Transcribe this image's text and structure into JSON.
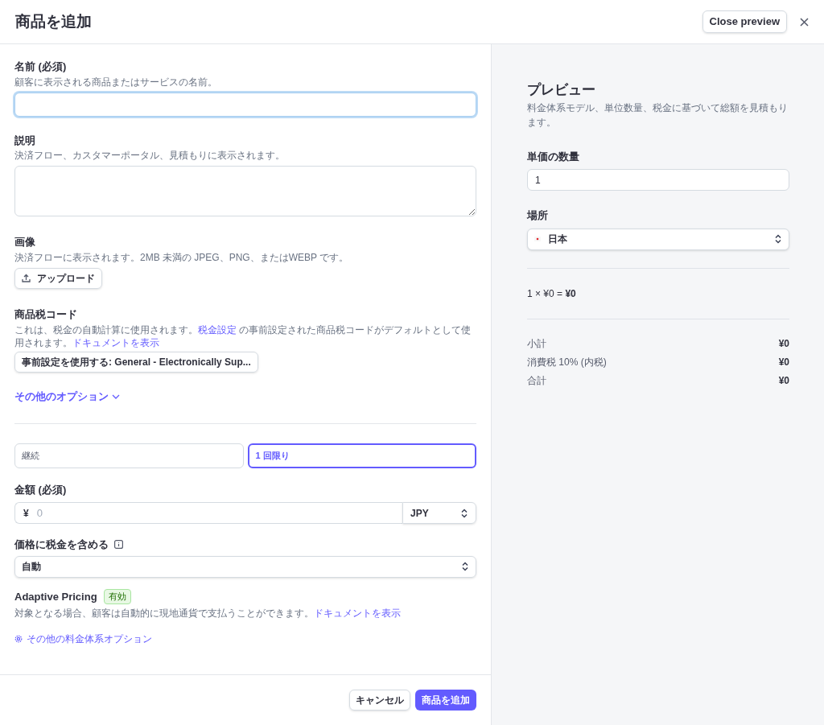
{
  "header": {
    "title": "商品を追加",
    "close_preview": "Close preview"
  },
  "name_field": {
    "label": "名前 (必須)",
    "hint": "顧客に表示される商品またはサービスの名前。",
    "focused": true
  },
  "description_field": {
    "label": "説明",
    "hint": "決済フロー、カスタマーポータル、見積もりに表示されます。"
  },
  "image_field": {
    "label": "画像",
    "hint": "決済フローに表示されます。2MB 未満の JPEG、PNG、またはWEBP です。",
    "button": "アップロード"
  },
  "tax_code": {
    "label": "商品税コード",
    "text_1": "これは、税金の自動計算に使用されます。",
    "link_1": "税金設定",
    "text_2": " の事前設定された商品税コードがデフォルトとして使用されます。",
    "link_2": "ドキュメントを表示",
    "button": "事前設定を使用する: General - Electronically Sup..."
  },
  "more_options": "その他のオプション",
  "pricing_types": [
    {
      "label": "継続",
      "selected": false
    },
    {
      "label": "1 回限り",
      "selected": true
    }
  ],
  "amount": {
    "label": "金額 (必須)",
    "symbol": "¥",
    "placeholder": "0",
    "currency": "JPY"
  },
  "tax_included": {
    "label": "価格に税金を含める",
    "value": "自動"
  },
  "adaptive_pricing": {
    "title": "Adaptive Pricing",
    "badge": "有効",
    "text": "対象となる場合、顧客は自動的に現地通貨で支払うことができます。",
    "link": "ドキュメントを表示"
  },
  "more_pricing_options": "その他の料金体系オプション",
  "footer": {
    "cancel": "キャンセル",
    "submit": "商品を追加"
  },
  "preview": {
    "title": "プレビュー",
    "subtitle": "料金体系モデル、単位数量、税金に基づいて総額を見積もります。",
    "quantity_label": "単価の数量",
    "quantity": "1",
    "location_label": "場所",
    "location": "日本",
    "formula": "1 × ¥0 = **¥0**",
    "summary": [
      {
        "label": "小計",
        "value": "¥0"
      },
      {
        "label": "消費税 10% (内税)",
        "value": "¥0"
      },
      {
        "label": "合計",
        "value": "¥0"
      }
    ]
  }
}
